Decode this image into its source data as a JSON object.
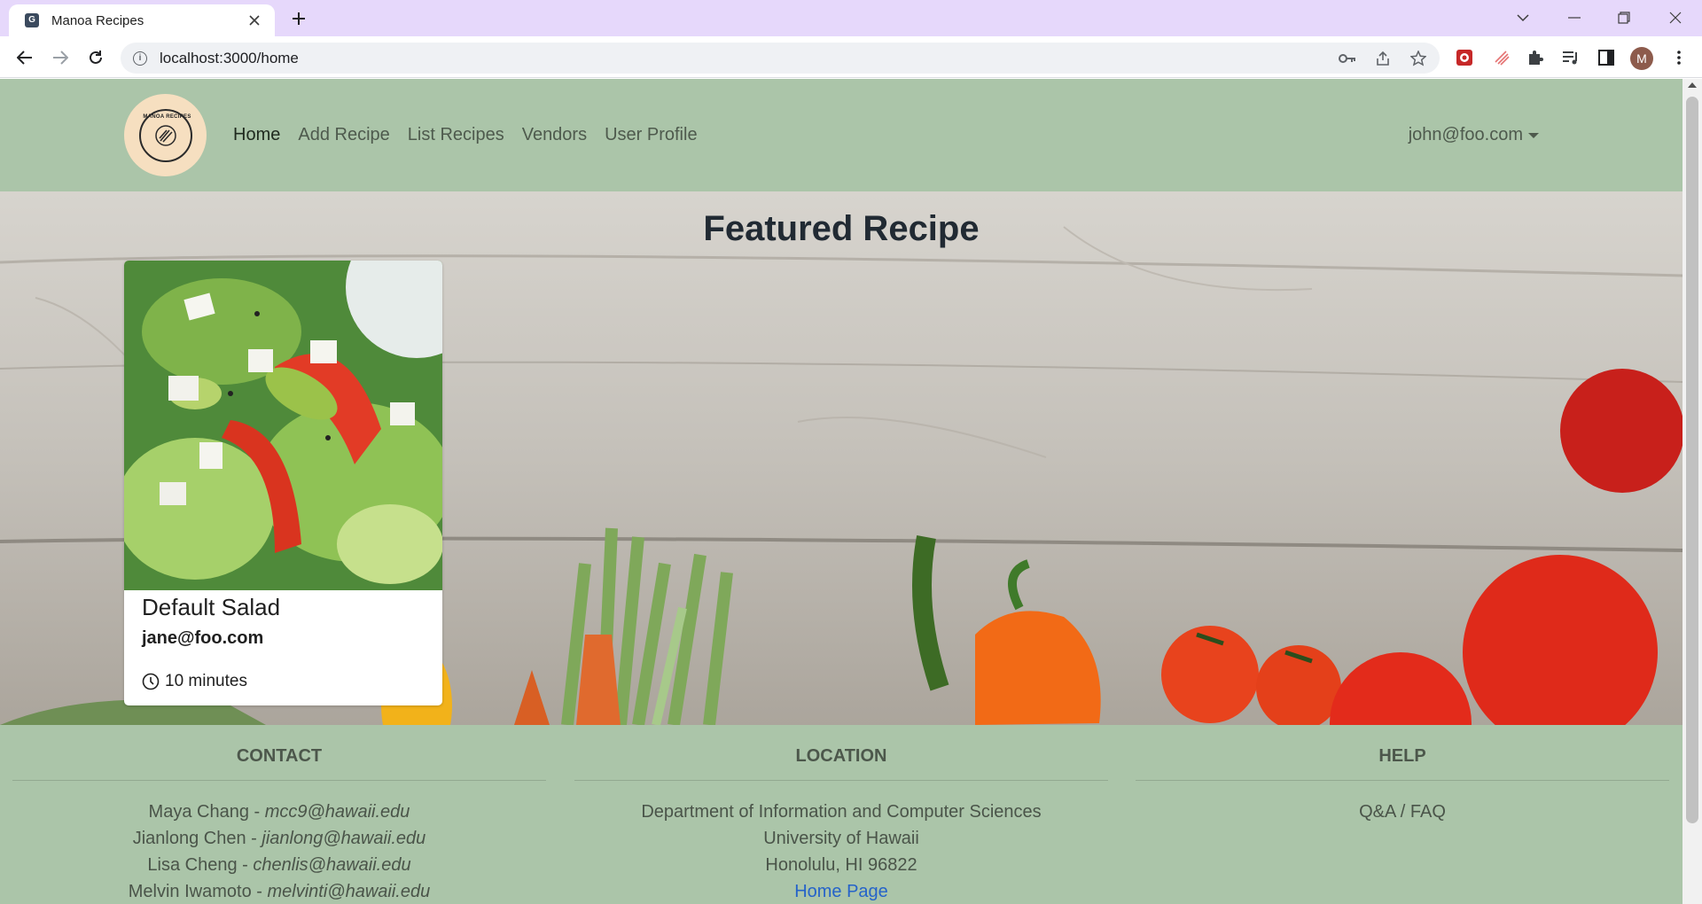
{
  "browser": {
    "tab_title": "Manoa Recipes",
    "tab_favicon_letter": "G",
    "url": "localhost:3000/home",
    "profile_initial": "M"
  },
  "nav": {
    "logo_text": "MANOA RECIPES",
    "links": [
      {
        "label": "Home",
        "active": true
      },
      {
        "label": "Add Recipe"
      },
      {
        "label": "List Recipes"
      },
      {
        "label": "Vendors"
      },
      {
        "label": "User Profile"
      }
    ],
    "user": "john@foo.com"
  },
  "hero": {
    "title": "Featured Recipe",
    "card": {
      "title": "Default Salad",
      "owner": "jane@foo.com",
      "time": "10 minutes"
    }
  },
  "footer": {
    "contact": {
      "heading": "CONTACT",
      "people": [
        {
          "name": "Maya Chang - ",
          "email": "mcc9@hawaii.edu"
        },
        {
          "name": "Jianlong Chen - ",
          "email": "jianlong@hawaii.edu"
        },
        {
          "name": "Lisa Cheng - ",
          "email": "chenlis@hawaii.edu"
        },
        {
          "name": "Melvin Iwamoto - ",
          "email": "melvinti@hawaii.edu"
        }
      ]
    },
    "location": {
      "heading": "LOCATION",
      "lines": [
        "Department of Information and Computer Sciences",
        "University of Hawaii",
        "Honolulu, HI 96822"
      ],
      "link": "Home Page"
    },
    "help": {
      "heading": "HELP",
      "link": "Q&A / FAQ"
    }
  },
  "colors": {
    "nav_bg": "#abc5a9",
    "logo_bg": "#f6dfc0",
    "tabbar_bg": "#e6d8fb",
    "link_blue": "#2563c9"
  }
}
